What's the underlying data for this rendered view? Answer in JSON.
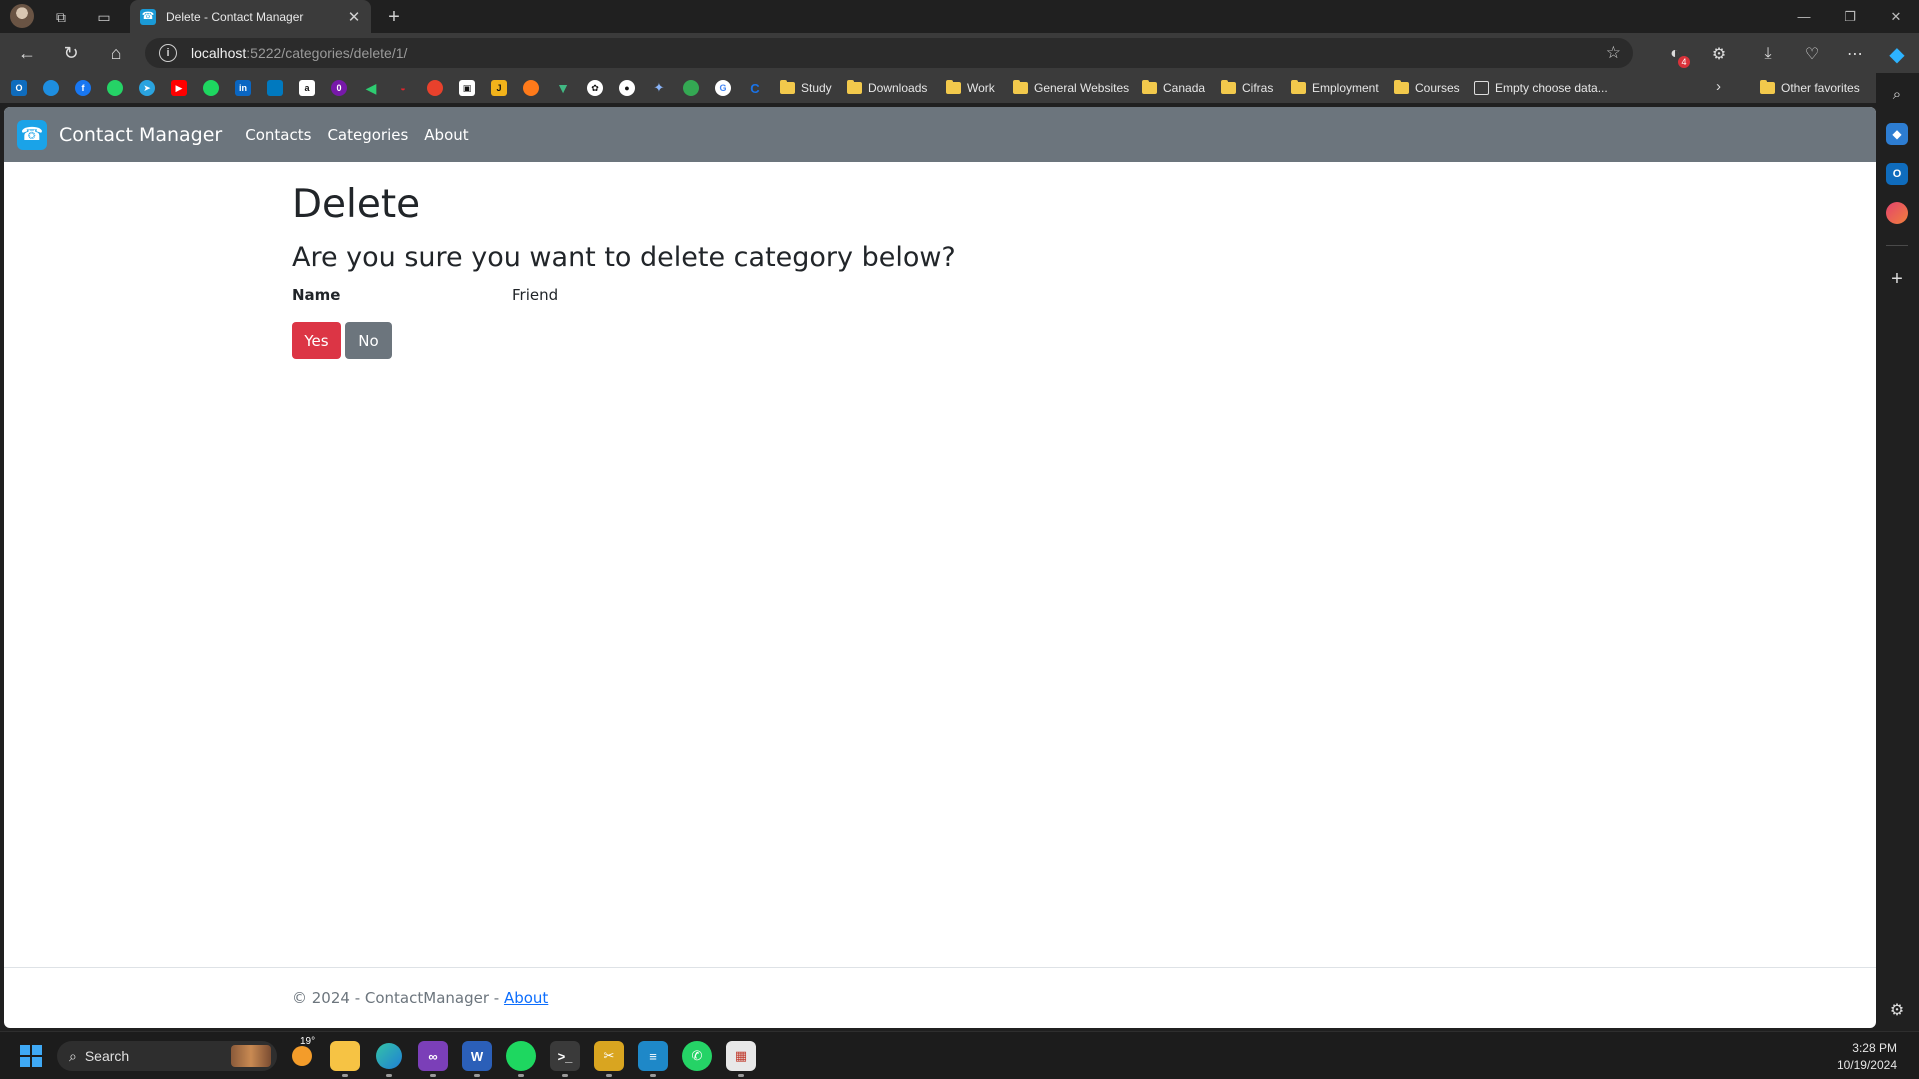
{
  "browser": {
    "tab_title": "Delete - Contact Manager",
    "url_host": "localhost",
    "url_path": ":5222/categories/delete/1/",
    "adblock_count": "4",
    "bookmarks": {
      "folders": [
        "Study",
        "Downloads",
        "Work",
        "General Websites",
        "Canada",
        "Cifras",
        "Employment",
        "Courses"
      ],
      "empty_choose_data": "Empty choose data...",
      "other_favorites": "Other favorites",
      "favicon_icons": [
        "outlook-icon",
        "onedrive-icon",
        "facebook-icon",
        "whatsapp-icon",
        "telegram-icon",
        "youtube-icon",
        "spotify-icon",
        "linkedin-icon",
        "trello-icon",
        "amazon-icon",
        "onenote-icon",
        "arrow-icon",
        "redhat-icon",
        "app-icon",
        "terminal-icon",
        "app-icon",
        "app-icon",
        "vue-icon",
        "chatgpt-icon",
        "github-icon",
        "gemini-icon",
        "app-icon",
        "google-icon",
        "app-icon"
      ]
    }
  },
  "site": {
    "brand": "Contact Manager",
    "nav": {
      "contacts": "Contacts",
      "categories": "Categories",
      "about": "About"
    },
    "heading": "Delete",
    "question": "Are you sure you want to delete category below?",
    "field_label": "Name",
    "field_value": "Friend",
    "yes_button": "Yes",
    "no_button": "No",
    "footer_text": "© 2024 - ContactManager - ",
    "footer_link": "About",
    "colors": {
      "navbar": "#6c757d",
      "danger": "#dc3545",
      "secondary": "#6c757d",
      "link": "#0d6efd"
    }
  },
  "taskbar": {
    "search_placeholder": "Search",
    "weather": "19°",
    "time": "3:28 PM",
    "date": "10/19/2024"
  }
}
